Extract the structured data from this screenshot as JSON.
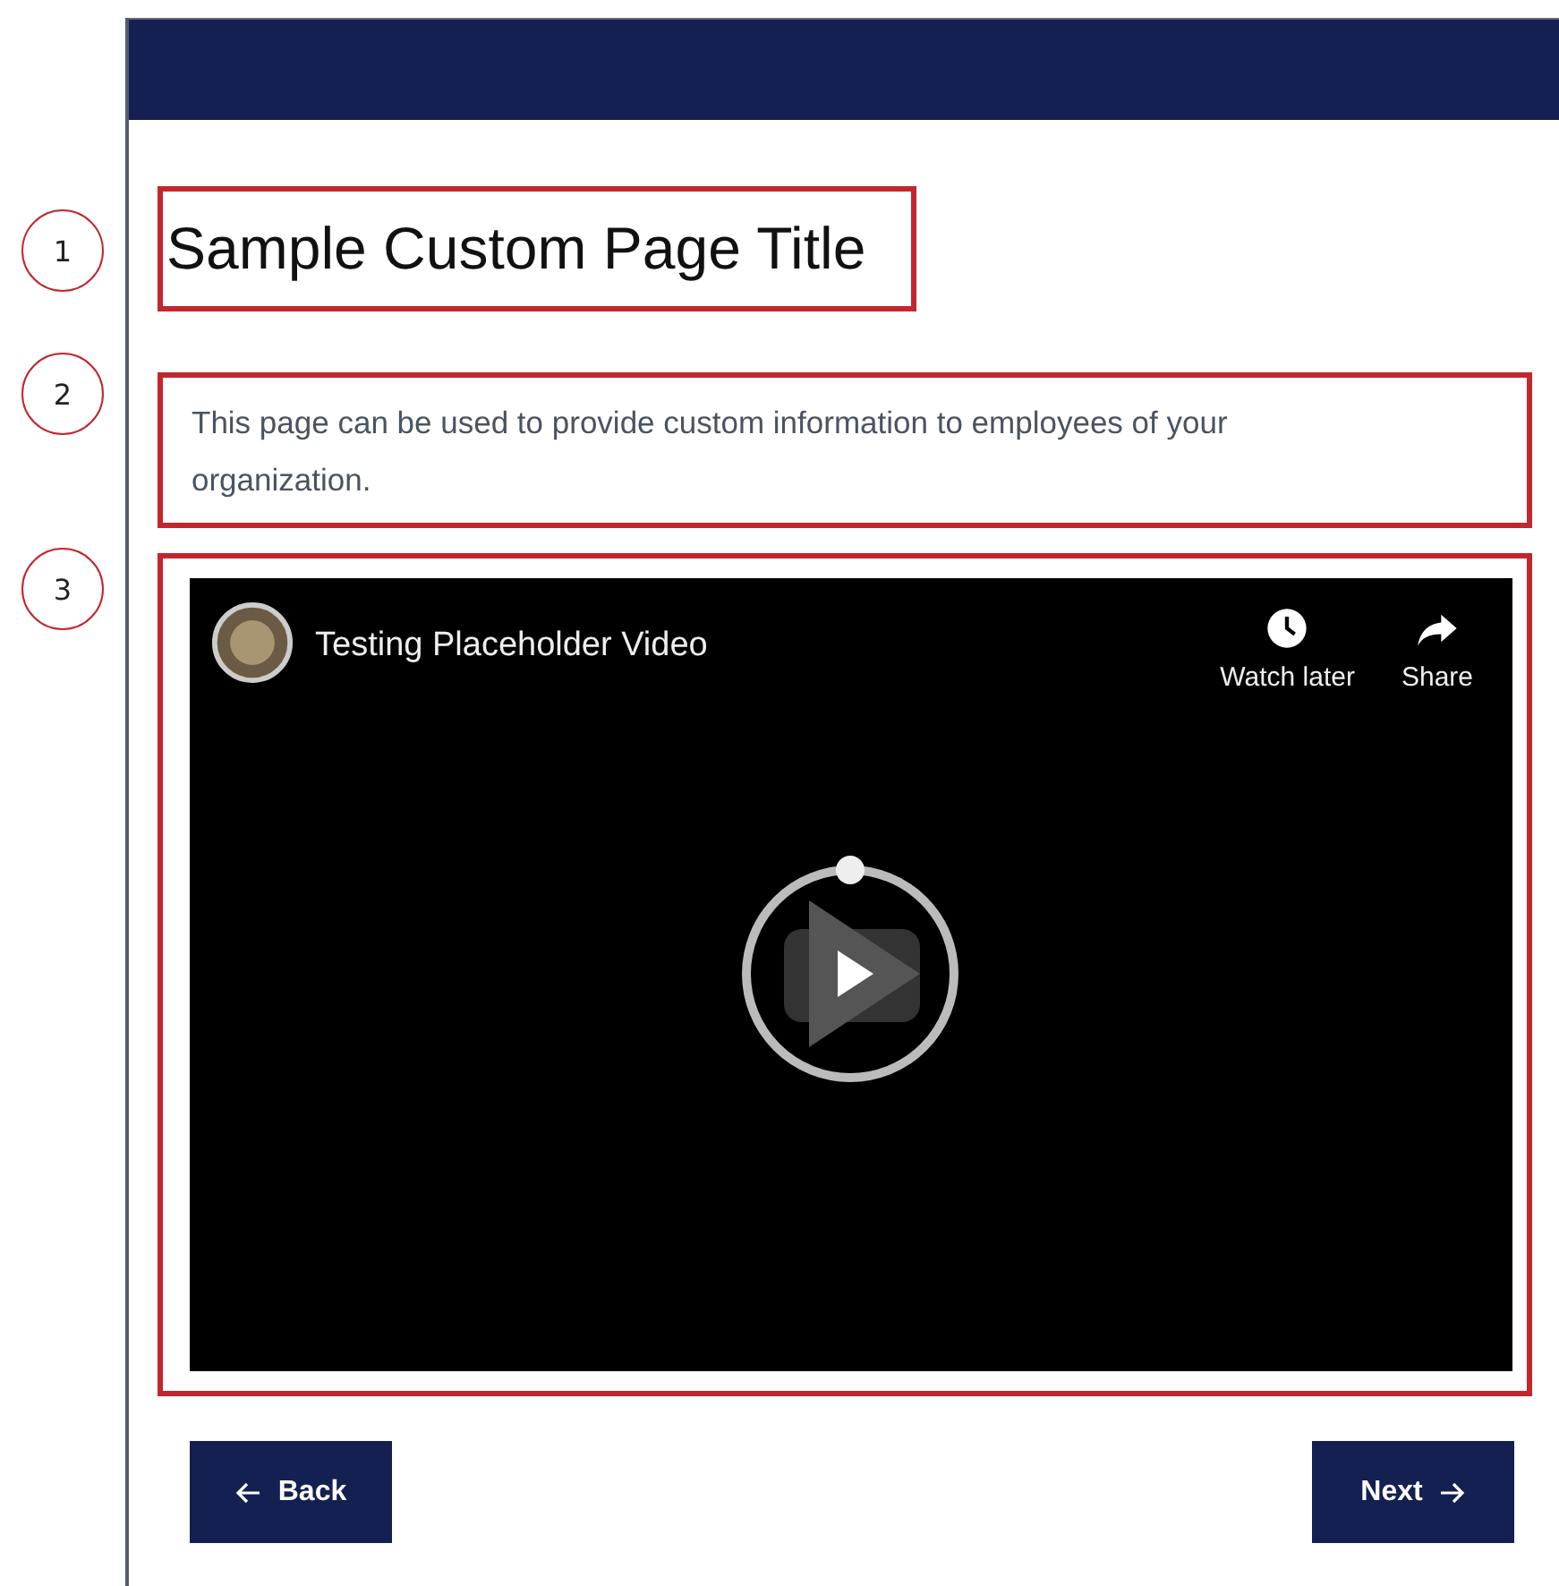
{
  "title": "Sample Custom Page Title",
  "description": "This page can be used to provide custom information to employees of your organization.",
  "video": {
    "kind": "picture",
    "title": "Testing Placeholder Video",
    "actions": [
      {
        "kind": "clock",
        "label": "Watch later"
      },
      {
        "kind": "share",
        "label": "Share"
      }
    ]
  },
  "callouts": [
    "1",
    "2",
    "3"
  ],
  "buttons": {
    "back": "Back",
    "next": "Next"
  }
}
